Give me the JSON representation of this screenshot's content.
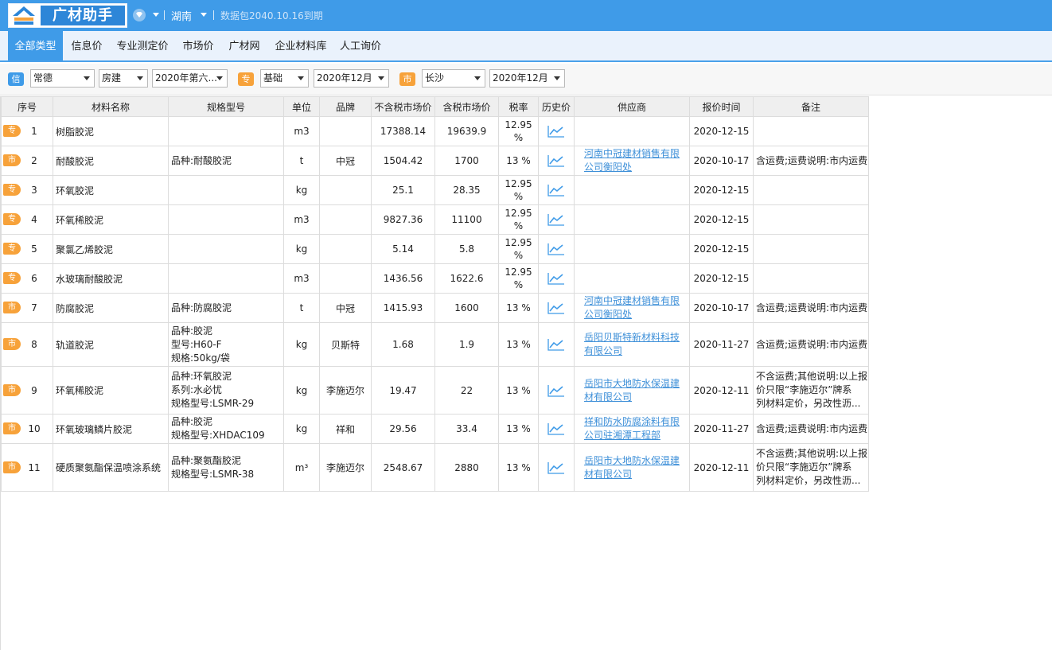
{
  "app": {
    "logo_text": "广材助手",
    "province": "湖南",
    "expire_notice": "数据包2040.10.16到期"
  },
  "tabs": [
    {
      "label": "全部类型",
      "active": true
    },
    {
      "label": "信息价"
    },
    {
      "label": "专业测定价"
    },
    {
      "label": "市场价"
    },
    {
      "label": "广材网"
    },
    {
      "label": "企业材料库"
    },
    {
      "label": "人工询价"
    }
  ],
  "filters": {
    "info": {
      "tag": "信",
      "city": "常德",
      "category": "房建",
      "period": "2020年第六..."
    },
    "pro": {
      "tag": "专",
      "category": "基础",
      "period": "2020年12月"
    },
    "market": {
      "tag": "市",
      "city": "长沙",
      "period": "2020年12月"
    }
  },
  "table": {
    "headers": [
      "序号",
      "材料名称",
      "规格型号",
      "单位",
      "品牌",
      "不含税市场价",
      "含税市场价",
      "税率",
      "历史价",
      "供应商",
      "报价时间",
      "备注"
    ],
    "rows": [
      {
        "type": "专",
        "no": "1",
        "name": "树脂胶泥",
        "spec": [],
        "unit": "m3",
        "brand": "",
        "price_ex": "17388.14",
        "price_in": "19639.9",
        "tax": [
          "12.95",
          "%"
        ],
        "supplier": [],
        "date": "2020-12-15",
        "remark": []
      },
      {
        "type": "市",
        "no": "2",
        "name": "耐酸胶泥",
        "spec": [
          "品种:耐酸胶泥"
        ],
        "unit": "t",
        "brand": "中冠",
        "price_ex": "1504.42",
        "price_in": "1700",
        "tax": [
          "13 %"
        ],
        "supplier": [
          "河南中冠建材销售有限",
          "公司衡阳处"
        ],
        "date": "2020-10-17",
        "remark": [
          "含运费;运费说明:市内运费"
        ]
      },
      {
        "type": "专",
        "no": "3",
        "name": "环氧胶泥",
        "spec": [],
        "unit": "kg",
        "brand": "",
        "price_ex": "25.1",
        "price_in": "28.35",
        "tax": [
          "12.95",
          "%"
        ],
        "supplier": [],
        "date": "2020-12-15",
        "remark": []
      },
      {
        "type": "专",
        "no": "4",
        "name": "环氧稀胶泥",
        "spec": [],
        "unit": "m3",
        "brand": "",
        "price_ex": "9827.36",
        "price_in": "11100",
        "tax": [
          "12.95",
          "%"
        ],
        "supplier": [],
        "date": "2020-12-15",
        "remark": []
      },
      {
        "type": "专",
        "no": "5",
        "name": "聚氯乙烯胶泥",
        "spec": [],
        "unit": "kg",
        "brand": "",
        "price_ex": "5.14",
        "price_in": "5.8",
        "tax": [
          "12.95",
          "%"
        ],
        "supplier": [],
        "date": "2020-12-15",
        "remark": []
      },
      {
        "type": "专",
        "no": "6",
        "name": "水玻璃耐酸胶泥",
        "spec": [],
        "unit": "m3",
        "brand": "",
        "price_ex": "1436.56",
        "price_in": "1622.6",
        "tax": [
          "12.95",
          "%"
        ],
        "supplier": [],
        "date": "2020-12-15",
        "remark": []
      },
      {
        "type": "市",
        "no": "7",
        "name": "防腐胶泥",
        "spec": [
          "品种:防腐胶泥"
        ],
        "unit": "t",
        "brand": "中冠",
        "price_ex": "1415.93",
        "price_in": "1600",
        "tax": [
          "13 %"
        ],
        "supplier": [
          "河南中冠建材销售有限",
          "公司衡阳处"
        ],
        "date": "2020-10-17",
        "remark": [
          "含运费;运费说明:市内运费"
        ]
      },
      {
        "type": "市",
        "no": "8",
        "name": "轨道胶泥",
        "spec": [
          "品种:胶泥",
          "型号:H60-F",
          "规格:50kg/袋"
        ],
        "unit": "kg",
        "brand": "贝斯特",
        "price_ex": "1.68",
        "price_in": "1.9",
        "tax": [
          "13 %"
        ],
        "supplier": [
          "岳阳贝斯特新材料科技",
          "有限公司"
        ],
        "date": "2020-11-27",
        "remark": [
          "含运费;运费说明:市内运费"
        ]
      },
      {
        "type": "市",
        "no": "9",
        "name": "环氧稀胶泥",
        "spec": [
          "品种:环氧胶泥",
          "系列:水必忧",
          "规格型号:LSMR-29"
        ],
        "unit": "kg",
        "brand": "李施迈尔",
        "price_ex": "19.47",
        "price_in": "22",
        "tax": [
          "13 %"
        ],
        "supplier": [
          "岳阳市大地防水保温建",
          "材有限公司"
        ],
        "date": "2020-12-11",
        "remark": [
          "不含运费;其他说明:以上报",
          "价只限“李施迈尔”牌系",
          "列材料定价，另改性沥..."
        ]
      },
      {
        "type": "市",
        "no": "10",
        "name": "环氧玻璃鳞片胶泥",
        "spec": [
          "品种:胶泥",
          "规格型号:XHDAC109"
        ],
        "unit": "kg",
        "brand": "祥和",
        "price_ex": "29.56",
        "price_in": "33.4",
        "tax": [
          "13 %"
        ],
        "supplier": [
          "祥和防水防腐涂料有限",
          "公司驻湘潭工程部"
        ],
        "date": "2020-11-27",
        "remark": [
          "含运费;运费说明:市内运费"
        ]
      },
      {
        "type": "市",
        "no": "11",
        "name": "硬质聚氨酯保温喷涂系统",
        "spec": [
          "品种:聚氨酯胶泥",
          "规格型号:LSMR-38"
        ],
        "unit": "m³",
        "brand": "李施迈尔",
        "price_ex": "2548.67",
        "price_in": "2880",
        "tax": [
          "13 %"
        ],
        "supplier": [
          "岳阳市大地防水保温建",
          "材有限公司"
        ],
        "date": "2020-12-11",
        "remark": [
          "不含运费;其他说明:以上报",
          "价只限“李施迈尔”牌系",
          "列材料定价，另改性沥..."
        ]
      }
    ]
  },
  "icons": {
    "logo": "logo-mark-icon",
    "vip": "diamond-icon",
    "history": "line-chart-icon"
  },
  "colors": {
    "primary": "#3f9be8",
    "tag_orange": "#f7a23a",
    "link": "#3d8fd8"
  }
}
